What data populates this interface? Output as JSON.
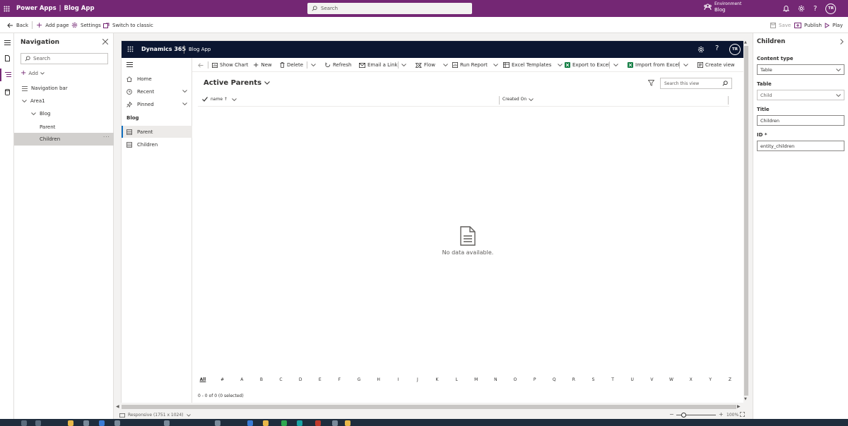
{
  "topbar": {
    "app_name": "Power Apps",
    "separator": "|",
    "app_title": "Blog App",
    "search_placeholder": "Search",
    "environment_label": "Environment",
    "environment_name": "Blog",
    "avatar_initials": "TR"
  },
  "commandbar": {
    "back": "Back",
    "add_page": "Add page",
    "settings": "Settings",
    "switch_classic": "Switch to classic",
    "save": "Save",
    "publish": "Publish",
    "play": "Play"
  },
  "navigation": {
    "title": "Navigation",
    "search_placeholder": "Search",
    "add_label": "Add",
    "tree": [
      {
        "label": "Navigation bar",
        "level": 0
      },
      {
        "label": "Area1",
        "level": 0
      },
      {
        "label": "Blog",
        "level": 1
      },
      {
        "label": "Parent",
        "level": 2
      },
      {
        "label": "Children",
        "level": 2,
        "selected": true
      }
    ]
  },
  "app_frame": {
    "brand": "Dynamics 365",
    "app_name": "Blog App",
    "avatar_initials": "TR",
    "sitemap": {
      "home": "Home",
      "recent": "Recent",
      "pinned": "Pinned",
      "group": "Blog",
      "items": [
        "Parent",
        "Children"
      ]
    },
    "grid_commands": {
      "show_chart": "Show Chart",
      "new": "New",
      "delete": "Delete",
      "refresh": "Refresh",
      "email_link": "Email a Link",
      "flow": "Flow",
      "run_report": "Run Report",
      "excel_templates": "Excel Templates",
      "export_excel": "Export to Excel",
      "import_excel": "Import from Excel",
      "create_view": "Create view"
    },
    "view_title": "Active Parents",
    "search_placeholder": "Search this view",
    "columns": [
      "name ↑",
      "Created On"
    ],
    "empty_message": "No data available.",
    "alphabet": [
      "All",
      "#",
      "A",
      "B",
      "C",
      "D",
      "E",
      "F",
      "G",
      "H",
      "I",
      "J",
      "K",
      "L",
      "M",
      "N",
      "O",
      "P",
      "Q",
      "R",
      "S",
      "T",
      "U",
      "V",
      "W",
      "X",
      "Y",
      "Z"
    ],
    "record_count": "0 - 0 of 0 (0 selected)"
  },
  "statusbar": {
    "responsive": "Responsive (1751 x 1024)",
    "zoom": "100%"
  },
  "properties": {
    "title": "Children",
    "content_type_label": "Content type",
    "content_type_value": "Table",
    "table_label": "Table",
    "table_value": "Child",
    "title_label": "Title",
    "title_value": "Children",
    "id_label": "ID *",
    "id_value": "entity_children"
  },
  "colors": {
    "brand_purple": "#742774",
    "d365_navy": "#0b1631",
    "selection_blue": "#106ebe"
  }
}
